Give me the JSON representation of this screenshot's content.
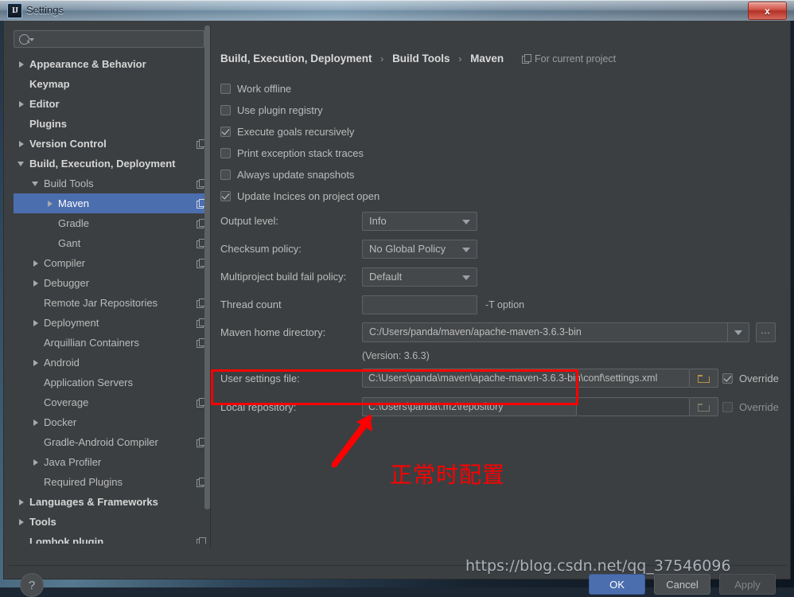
{
  "window": {
    "title": "Settings",
    "app_icon": "intellij-idea-icon",
    "close_label": "x"
  },
  "search": {
    "placeholder": "",
    "icon": "search-icon"
  },
  "sidebar": {
    "items": [
      {
        "label": "Appearance & Behavior",
        "indent": 1,
        "twisty": "collapsed",
        "bold": true,
        "copy": false,
        "selected": false
      },
      {
        "label": "Keymap",
        "indent": 1,
        "twisty": "none",
        "bold": true,
        "copy": false,
        "selected": false
      },
      {
        "label": "Editor",
        "indent": 1,
        "twisty": "collapsed",
        "bold": true,
        "copy": false,
        "selected": false
      },
      {
        "label": "Plugins",
        "indent": 1,
        "twisty": "none",
        "bold": true,
        "copy": false,
        "selected": false
      },
      {
        "label": "Version Control",
        "indent": 1,
        "twisty": "collapsed",
        "bold": true,
        "copy": true,
        "selected": false
      },
      {
        "label": "Build, Execution, Deployment",
        "indent": 1,
        "twisty": "expanded",
        "bold": true,
        "copy": false,
        "selected": false
      },
      {
        "label": "Build Tools",
        "indent": 2,
        "twisty": "expanded",
        "bold": false,
        "copy": true,
        "selected": false
      },
      {
        "label": "Maven",
        "indent": 3,
        "twisty": "collapsed",
        "bold": false,
        "copy": true,
        "selected": true
      },
      {
        "label": "Gradle",
        "indent": 3,
        "twisty": "none",
        "bold": false,
        "copy": true,
        "selected": false
      },
      {
        "label": "Gant",
        "indent": 3,
        "twisty": "none",
        "bold": false,
        "copy": true,
        "selected": false
      },
      {
        "label": "Compiler",
        "indent": 2,
        "twisty": "collapsed",
        "bold": false,
        "copy": true,
        "selected": false
      },
      {
        "label": "Debugger",
        "indent": 2,
        "twisty": "collapsed",
        "bold": false,
        "copy": false,
        "selected": false
      },
      {
        "label": "Remote Jar Repositories",
        "indent": 2,
        "twisty": "none",
        "bold": false,
        "copy": true,
        "selected": false
      },
      {
        "label": "Deployment",
        "indent": 2,
        "twisty": "collapsed",
        "bold": false,
        "copy": true,
        "selected": false
      },
      {
        "label": "Arquillian Containers",
        "indent": 2,
        "twisty": "none",
        "bold": false,
        "copy": true,
        "selected": false
      },
      {
        "label": "Android",
        "indent": 2,
        "twisty": "collapsed",
        "bold": false,
        "copy": false,
        "selected": false
      },
      {
        "label": "Application Servers",
        "indent": 2,
        "twisty": "none",
        "bold": false,
        "copy": false,
        "selected": false
      },
      {
        "label": "Coverage",
        "indent": 2,
        "twisty": "none",
        "bold": false,
        "copy": true,
        "selected": false
      },
      {
        "label": "Docker",
        "indent": 2,
        "twisty": "collapsed",
        "bold": false,
        "copy": false,
        "selected": false
      },
      {
        "label": "Gradle-Android Compiler",
        "indent": 2,
        "twisty": "none",
        "bold": false,
        "copy": true,
        "selected": false
      },
      {
        "label": "Java Profiler",
        "indent": 2,
        "twisty": "collapsed",
        "bold": false,
        "copy": false,
        "selected": false
      },
      {
        "label": "Required Plugins",
        "indent": 2,
        "twisty": "none",
        "bold": false,
        "copy": true,
        "selected": false
      },
      {
        "label": "Languages & Frameworks",
        "indent": 1,
        "twisty": "collapsed",
        "bold": true,
        "copy": false,
        "selected": false
      },
      {
        "label": "Tools",
        "indent": 1,
        "twisty": "collapsed",
        "bold": true,
        "copy": false,
        "selected": false
      },
      {
        "label": "Lombok plugin",
        "indent": 1,
        "twisty": "none",
        "bold": true,
        "copy": true,
        "selected": false
      }
    ]
  },
  "breadcrumb": {
    "part1": "Build, Execution, Deployment",
    "part2": "Build Tools",
    "part3": "Maven",
    "separator": "›",
    "for_current_project": "For current project"
  },
  "options": {
    "checkboxes": [
      {
        "label": "Work offline",
        "checked": false
      },
      {
        "label": "Use plugin registry",
        "checked": false
      },
      {
        "label": "Execute goals recursively",
        "checked": true
      },
      {
        "label": "Print exception stack traces",
        "checked": false
      },
      {
        "label": "Always update snapshots",
        "checked": false
      },
      {
        "label": "Update Incices on project open",
        "checked": true
      }
    ],
    "output_level": {
      "label": "Output level:",
      "value": "Info"
    },
    "checksum_policy": {
      "label": "Checksum policy:",
      "value": "No Global Policy"
    },
    "multiproject_fail_policy": {
      "label": "Multiproject build fail policy:",
      "value": "Default"
    },
    "thread_count": {
      "label": "Thread count",
      "value": "",
      "suffix": "-T option"
    },
    "maven_home": {
      "label": "Maven home directory:",
      "value": "C:/Users/panda/maven/apache-maven-3.6.3-bin",
      "browse_label": "...",
      "version_note": "(Version: 3.6.3)"
    },
    "user_settings": {
      "label": "User settings file:",
      "value": "C:\\Users\\panda\\maven\\apache-maven-3.6.3-bin\\conf\\settings.xml",
      "override_label": "Override",
      "override_checked": true
    },
    "local_repository": {
      "label": "Local repository:",
      "value": "C:\\Users\\panda\\.m2\\repository",
      "override_label": "Override",
      "override_checked": false
    }
  },
  "annotation": {
    "text": "正常时配置",
    "color": "#fe0000"
  },
  "footer": {
    "help_label": "?",
    "ok_label": "OK",
    "cancel_label": "Cancel",
    "apply_label": "Apply",
    "watermark": "https://blog.csdn.net/qq_37546096"
  }
}
